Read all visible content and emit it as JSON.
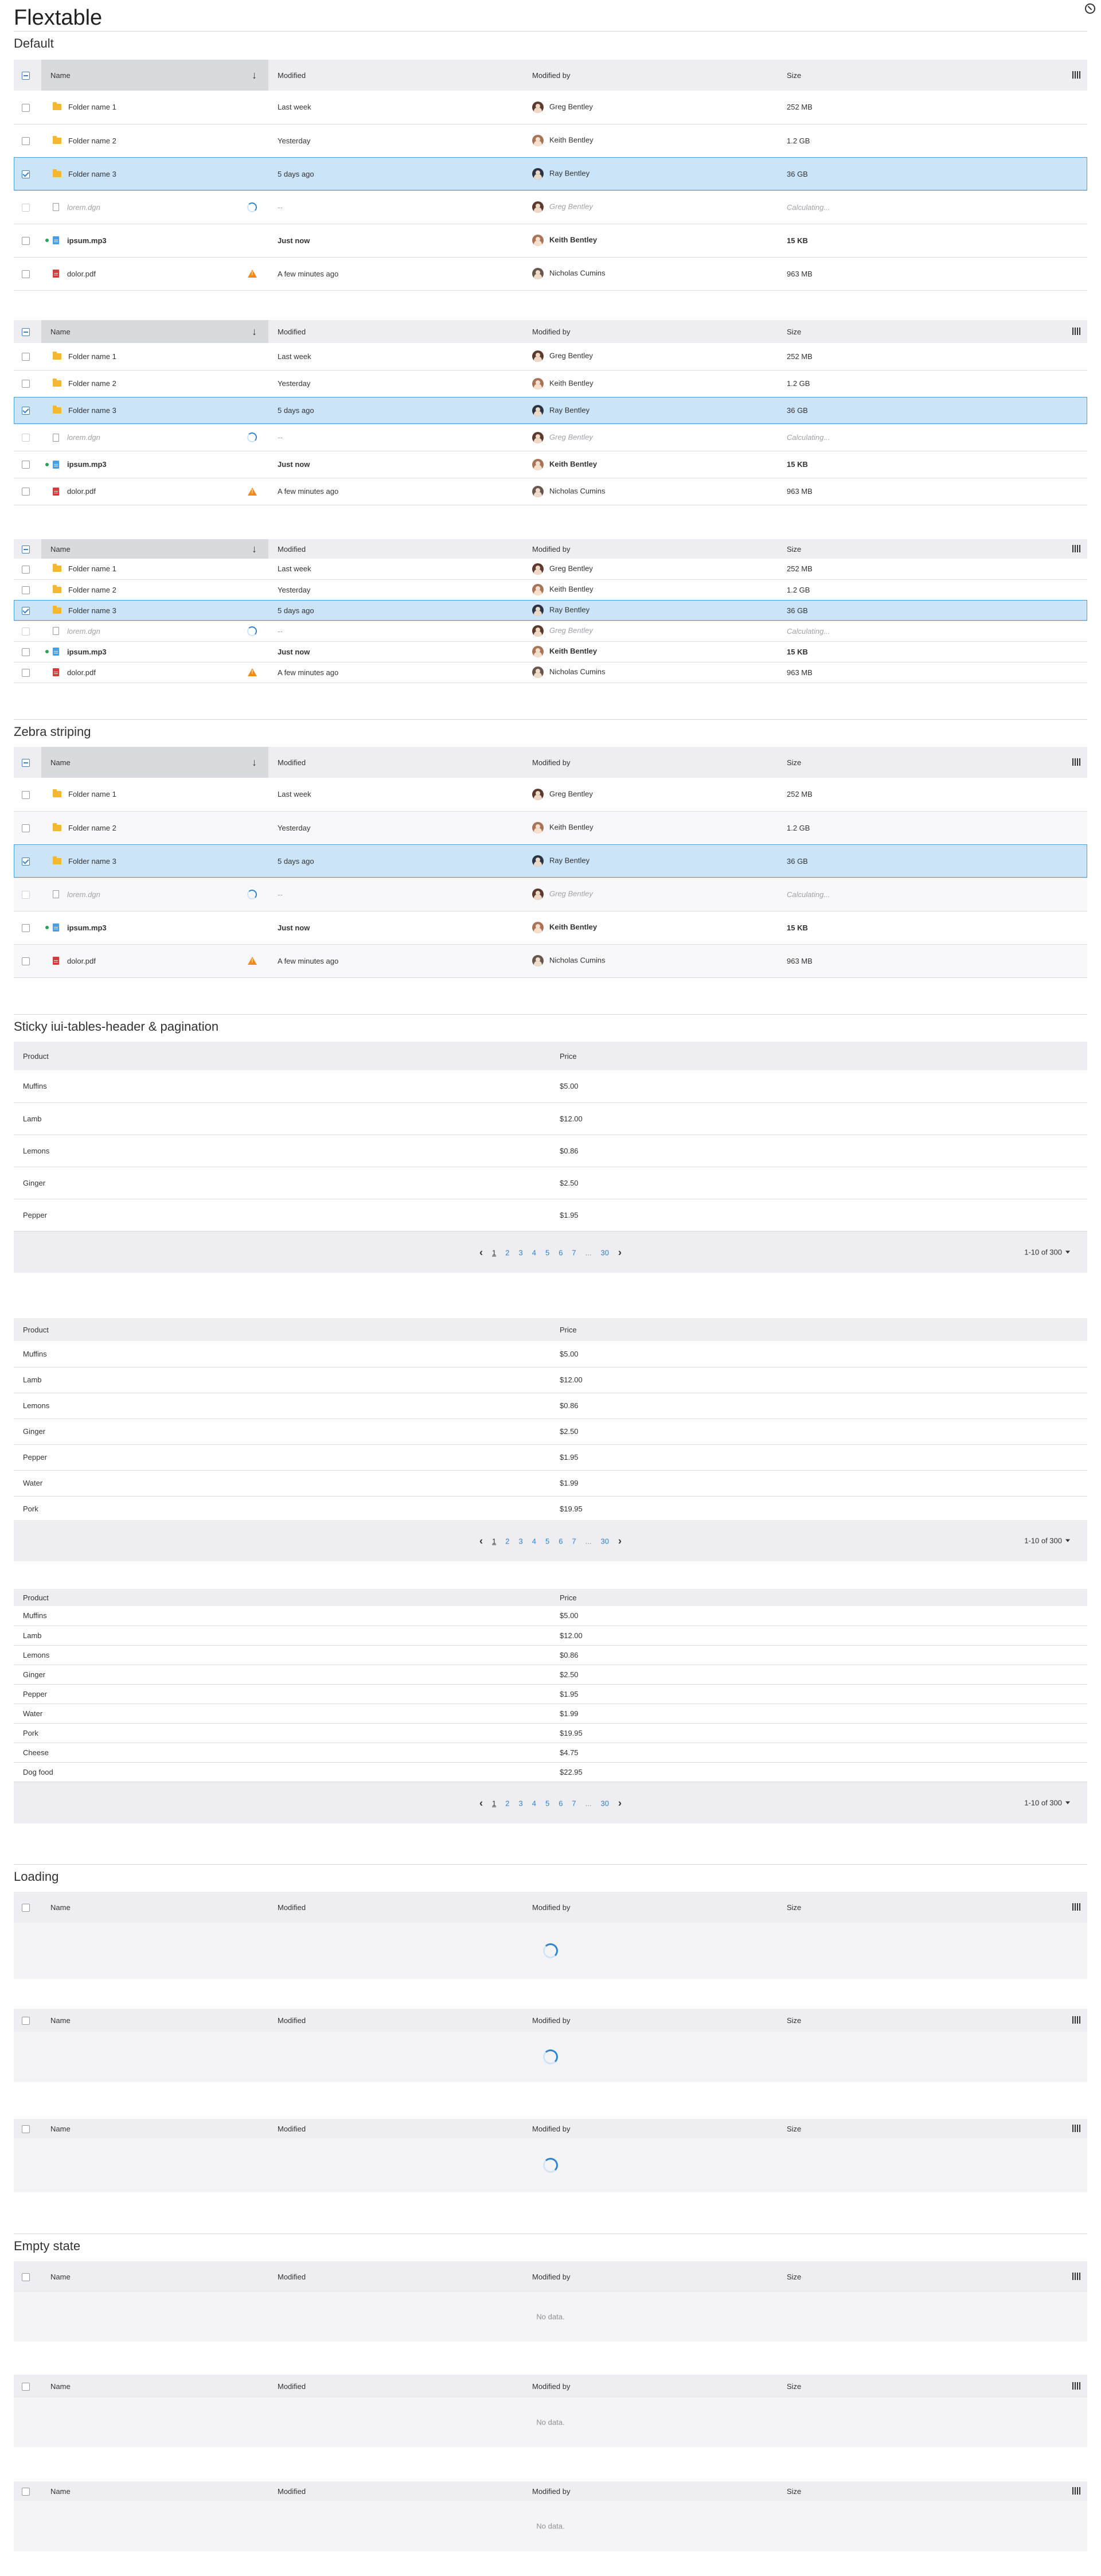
{
  "page": {
    "title": "Flextable"
  },
  "sections": {
    "default": "Default",
    "zebra": "Zebra striping",
    "sticky": "Sticky iui-tables-header & pagination",
    "loading": "Loading",
    "empty": "Empty state"
  },
  "columns": {
    "name": "Name",
    "modified": "Modified",
    "modified_by": "Modified by",
    "size": "Size"
  },
  "files": [
    {
      "name": "Folder name 1",
      "type": "folder",
      "modified": "Last week",
      "by": "Greg Bentley",
      "avatar": "greg",
      "size": "252 MB",
      "state": "normal"
    },
    {
      "name": "Folder name 2",
      "type": "folder",
      "modified": "Yesterday",
      "by": "Keith Bentley",
      "avatar": "keith",
      "size": "1.2 GB",
      "state": "normal"
    },
    {
      "name": "Folder name 3",
      "type": "folder",
      "modified": "5 days ago",
      "by": "Ray Bentley",
      "avatar": "ray",
      "size": "36 GB",
      "state": "selected"
    },
    {
      "name": "lorem.dgn",
      "type": "dgn",
      "modified": "--",
      "by": "Greg Bentley",
      "avatar": "greg",
      "size": "Calculating...",
      "state": "loading"
    },
    {
      "name": "ipsum.mp3",
      "type": "mp3",
      "modified": "Just now",
      "by": "Keith Bentley",
      "avatar": "keith",
      "size": "15 KB",
      "state": "new"
    },
    {
      "name": "dolor.pdf",
      "type": "pdf",
      "modified": "A few minutes ago",
      "by": "Nicholas Cumins",
      "avatar": "nick",
      "size": "963 MB",
      "state": "warning"
    }
  ],
  "product_columns": {
    "product": "Product",
    "price": "Price"
  },
  "products": [
    {
      "name": "Muffins",
      "price": "$5.00"
    },
    {
      "name": "Lamb",
      "price": "$12.00"
    },
    {
      "name": "Lemons",
      "price": "$0.86"
    },
    {
      "name": "Ginger",
      "price": "$2.50"
    },
    {
      "name": "Pepper",
      "price": "$1.95"
    },
    {
      "name": "Water",
      "price": "$1.99"
    },
    {
      "name": "Pork",
      "price": "$19.95"
    },
    {
      "name": "Cheese",
      "price": "$4.75"
    },
    {
      "name": "Dog food",
      "price": "$22.95"
    }
  ],
  "pagination": {
    "pages": [
      "1",
      "2",
      "3",
      "4",
      "5",
      "6",
      "7",
      "...",
      "30"
    ],
    "current": "1",
    "range": "1-10 of 300",
    "prev_icon": "chevron-left-icon",
    "next_icon": "chevron-right-icon"
  },
  "empty_text": "No data.",
  "colors": {
    "accent": "#2f84d2",
    "selected_bg": "#cce4f7",
    "header_bg": "#eeeef2",
    "warning": "#ef8b1c"
  }
}
